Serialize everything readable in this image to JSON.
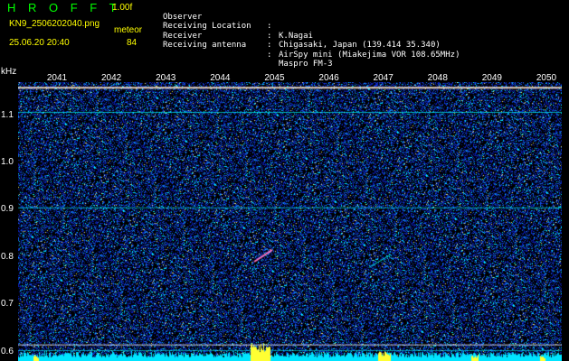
{
  "header": {
    "app_name": "H R O F F T",
    "version": "1.00f",
    "filename": "KN9_2506202040.png",
    "mode_label": "meteor",
    "datetime": "25.06.20 20:40",
    "count": "84"
  },
  "info": [
    {
      "key": "Observer",
      "sep": ":",
      "value": "K.Nagai"
    },
    {
      "key": "Receiving Location",
      "sep": ":",
      "value": "Chigasaki, Japan (139.414 35.340)"
    },
    {
      "key": "Receiver",
      "sep": ":",
      "value": "AirSpy mini (Miakejima VOR 108.65MHz)"
    },
    {
      "key": "Receiving antenna",
      "sep": ":",
      "value": "Maspro FM-3"
    }
  ],
  "chart_data": {
    "type": "heatmap",
    "ylabel": "kHz",
    "y_ticks": [
      "1.1",
      "1.0",
      "0.9",
      "0.8",
      "0.7",
      "0.6"
    ],
    "x_ticks": [
      "2041",
      "2042",
      "2043",
      "2044",
      "2045",
      "2046",
      "2047",
      "2048",
      "2049",
      "2050"
    ],
    "ylim": [
      0.58,
      1.17
    ],
    "colors": {
      "background": "#000000",
      "noise": "#1a2aa0",
      "signal": "#00ffff",
      "strong": "#ffff00",
      "hot": "#ff3300",
      "baseline": "#00ffff"
    }
  }
}
